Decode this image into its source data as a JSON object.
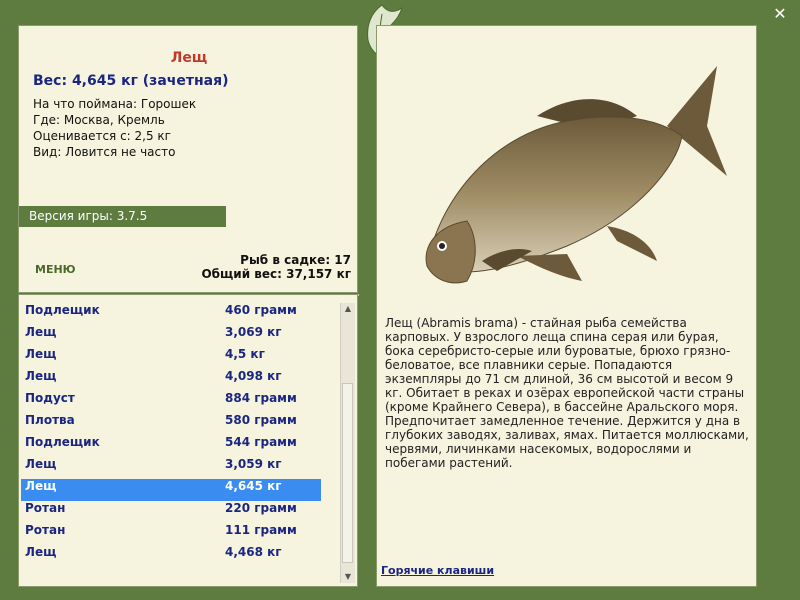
{
  "close_icon": "close-icon",
  "fish": {
    "name": "Лещ",
    "weight_line": "Вес: 4,645 кг (зачетная)",
    "caught_on": "На что поймана: Горошек",
    "where": "Где: Москва, Кремль",
    "rated_from": "Оценивается с: 2,5 кг",
    "kind": "Вид: Ловится не часто"
  },
  "version": "Версия игры: 3.7.5",
  "menu_label": "МЕНЮ",
  "sadok": {
    "count_line": "Рыб в садке: 17",
    "total_line": "Общий вес: 37,157 кг"
  },
  "catch_list": [
    {
      "name": "Подлещик",
      "weight": "460 грамм"
    },
    {
      "name": "Лещ",
      "weight": "3,069 кг"
    },
    {
      "name": "Лещ",
      "weight": "4,5 кг"
    },
    {
      "name": "Лещ",
      "weight": "4,098 кг"
    },
    {
      "name": "Подуст",
      "weight": "884 грамм"
    },
    {
      "name": "Плотва",
      "weight": "580 грамм"
    },
    {
      "name": "Подлещик",
      "weight": "544 грамм"
    },
    {
      "name": "Лещ",
      "weight": "3,059 кг"
    },
    {
      "name": "Лещ",
      "weight": "4,645 кг",
      "selected": true
    },
    {
      "name": "Ротан",
      "weight": "220 грамм"
    },
    {
      "name": "Ротан",
      "weight": "111 грамм"
    },
    {
      "name": "Лещ",
      "weight": "4,468 кг"
    }
  ],
  "description": "Лещ (Abramis brama) - стайная рыба семейства карповых. У взрослого леща спина серая или бурая, бока серебристо-серые или буроватые, брюхо грязно-беловатое, все плавники серые. Попадаются экземпляры до 71 см длиной, 36 см высотой и весом 9 кг. Обитает в реках и озёрах европейской части страны (кроме Крайнего Севера), в бассейне Аральского моря. Предпочитает замедленное течение. Держится у дна в глубоких заводях, заливах, ямах. Питается моллюсками, червями, личинками насекомых, водорослями и побегами растений.",
  "hotkeys_label": "Горячие клавиши",
  "colors": {
    "frame": "#5e7c40",
    "panel": "#f6f3df",
    "title": "#c0392b",
    "navy": "#1a2680",
    "selection": "#3b8cf0"
  }
}
